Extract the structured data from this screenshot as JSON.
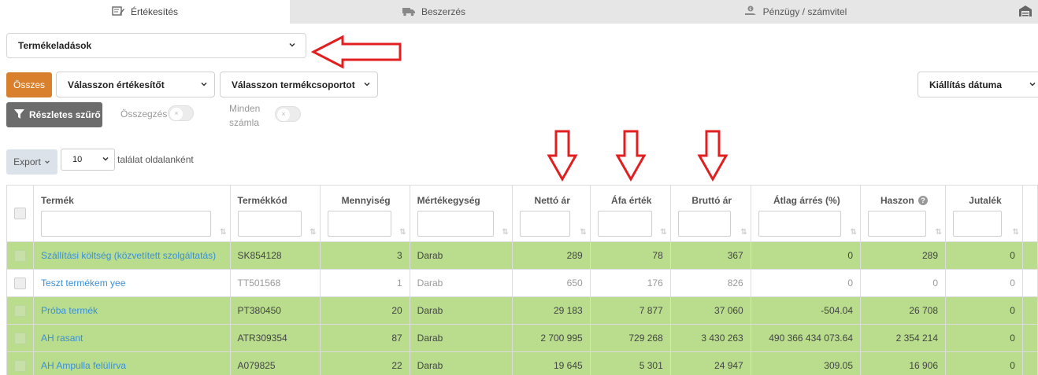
{
  "tabs": [
    {
      "label": "Értékesítés",
      "icon": "pencil-paper-icon",
      "active": true
    },
    {
      "label": "Beszerzés",
      "icon": "truck-icon",
      "active": false
    },
    {
      "label": "Pénzügy / számvitel",
      "icon": "money-hand-icon",
      "active": false
    },
    {
      "label": "",
      "icon": "warehouse-icon",
      "active": false
    }
  ],
  "report_select": {
    "value": "Termékeladások"
  },
  "filters": {
    "all_label": "Összes",
    "seller_placeholder": "Válasszon értékesítőt",
    "group_placeholder": "Válasszon termékcsoportot",
    "date_label": "Kiállítás dátuma",
    "detailed_filter_label": "Részletes szűrő",
    "summary_label": "Összegzés",
    "all_invoices_label_1": "Minden",
    "all_invoices_label_2": "számla"
  },
  "export": {
    "label": "Export",
    "per_page_value": "10",
    "per_page_text": "találat oldalanként"
  },
  "table": {
    "columns": [
      "Termék",
      "Termékkód",
      "Mennyiség",
      "Mértékegység",
      "Nettó ár",
      "Áfa érték",
      "Bruttó ár",
      "Átlag árrés (%)",
      "Haszon",
      "Jutalék"
    ],
    "rows": [
      {
        "name": "Szállítási költség (közvetített szolgáltatás)",
        "code": "SK854128",
        "qty": "3",
        "unit": "Darab",
        "net": "289",
        "vat": "78",
        "gross": "367",
        "margin": "0",
        "profit": "289",
        "commission": "0",
        "style": "green"
      },
      {
        "name": "Teszt termékem yee",
        "code": "TT501568",
        "qty": "1",
        "unit": "Darab",
        "net": "650",
        "vat": "176",
        "gross": "826",
        "margin": "0",
        "profit": "0",
        "commission": "0",
        "style": "white"
      },
      {
        "name": "Próba termék",
        "code": "PT380450",
        "qty": "20",
        "unit": "Darab",
        "net": "29 183",
        "vat": "7 877",
        "gross": "37 060",
        "margin": "-504.04",
        "profit": "26 708",
        "commission": "0",
        "style": "green"
      },
      {
        "name": "AH rasant",
        "code": "ATR309354",
        "qty": "87",
        "unit": "Darab",
        "net": "2 700 995",
        "vat": "729 268",
        "gross": "3 430 263",
        "margin": "490 366 434 073.64",
        "profit": "2 354 214",
        "commission": "0",
        "style": "green"
      },
      {
        "name": "AH Ampulla felülírva",
        "code": "A079825",
        "qty": "22",
        "unit": "Darab",
        "net": "19 645",
        "vat": "5 301",
        "gross": "24 947",
        "margin": "309.05",
        "profit": "16 906",
        "commission": "0",
        "style": "green"
      }
    ]
  },
  "colors": {
    "accent_orange": "#d9802c",
    "row_green": "#b9dd8d",
    "link_blue": "#3a8fd8",
    "annotation_red": "#e02020"
  }
}
